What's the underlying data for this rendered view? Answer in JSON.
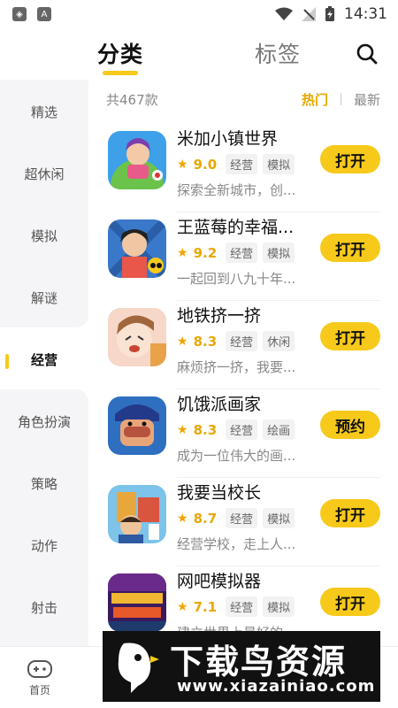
{
  "status_bar": {
    "time": "14:31"
  },
  "header": {
    "tabs": [
      "分类",
      "标签"
    ]
  },
  "sidebar": {
    "items": [
      "精选",
      "超休闲",
      "模拟",
      "解谜",
      "经营",
      "角色扮演",
      "策略",
      "动作",
      "射击"
    ],
    "selected": "经营"
  },
  "list_header": {
    "count": "共467款",
    "sort_hot": "热门",
    "sort_new": "最新"
  },
  "games": [
    {
      "name": "米加小镇世界",
      "rating": "9.0",
      "tags": [
        "经营",
        "模拟"
      ],
      "desc": "探索全新城市，创...",
      "button": "打开"
    },
    {
      "name": "王蓝莓的幸福...",
      "rating": "9.2",
      "tags": [
        "经营",
        "模拟"
      ],
      "desc": "一起回到八九十年...",
      "button": "打开"
    },
    {
      "name": "地铁挤一挤",
      "rating": "8.3",
      "tags": [
        "经营",
        "休闲"
      ],
      "desc": "麻烦挤一挤，我要...",
      "button": "打开"
    },
    {
      "name": "饥饿派画家",
      "rating": "8.3",
      "tags": [
        "经营",
        "绘画"
      ],
      "desc": "成为一位伟大的画...",
      "button": "预约"
    },
    {
      "name": "我要当校长",
      "rating": "8.7",
      "tags": [
        "经营",
        "模拟"
      ],
      "desc": "经营学校，走上人...",
      "button": "打开"
    },
    {
      "name": "网吧模拟器",
      "rating": "7.1",
      "tags": [
        "经营",
        "模拟"
      ],
      "desc": "建立世界上最好的...",
      "button": "打开"
    }
  ],
  "bottom_nav": {
    "home": "首页"
  },
  "watermark": {
    "title": "下载鸟资源",
    "url": "www.xiazainiao.com"
  },
  "colors": {
    "accent": "#f7c91a",
    "rating": "#e8a800"
  }
}
